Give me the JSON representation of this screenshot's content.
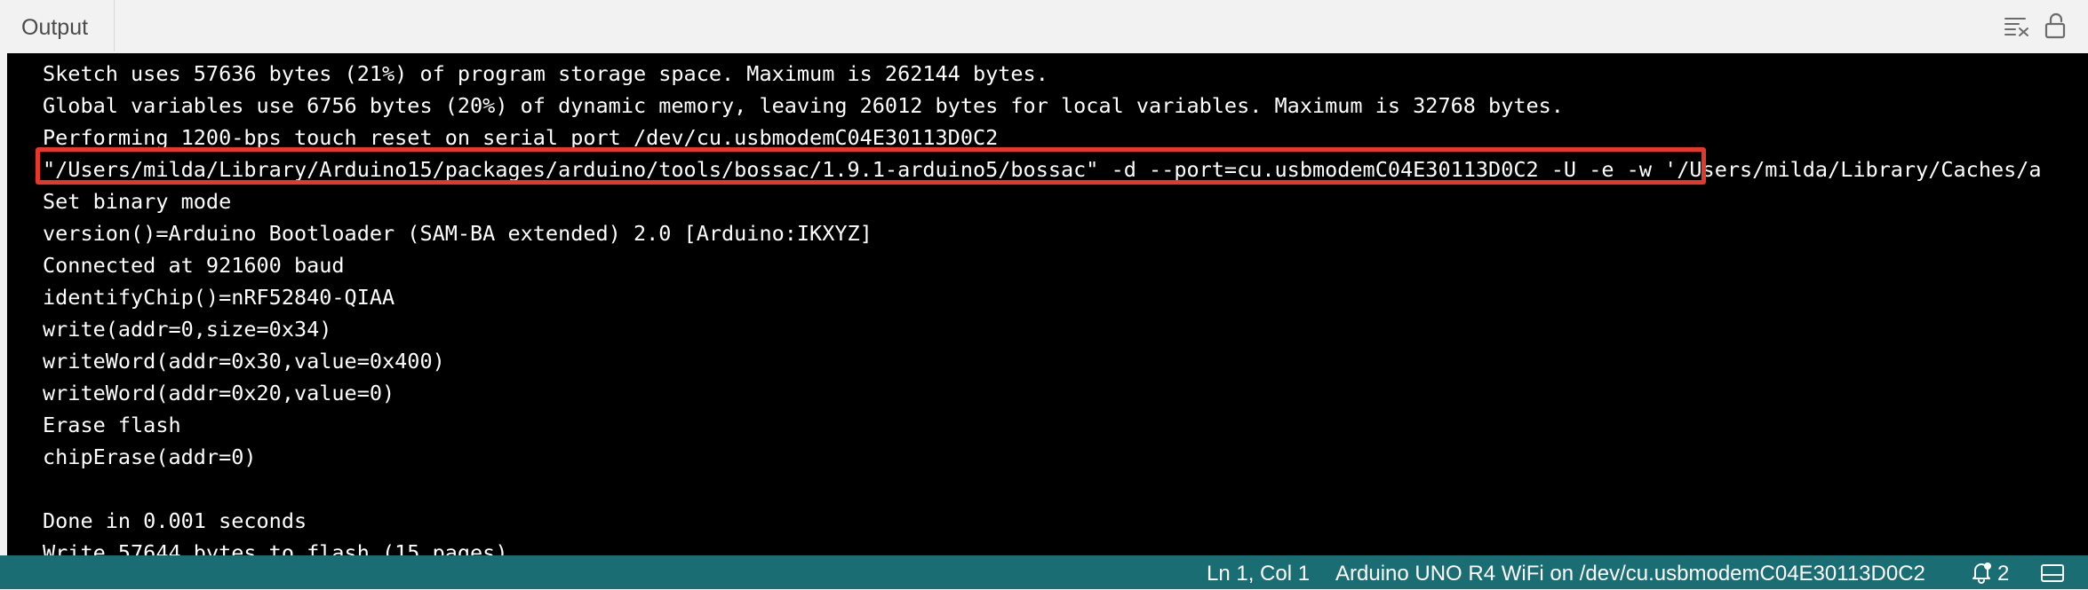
{
  "header": {
    "tab_label": "Output",
    "icons": {
      "clear": "clear-output-icon",
      "lock": "unlock-scroll-icon"
    }
  },
  "console": {
    "lines": [
      "Sketch uses 57636 bytes (21%) of program storage space. Maximum is 262144 bytes.",
      "Global variables use 6756 bytes (20%) of dynamic memory, leaving 26012 bytes for local variables. Maximum is 32768 bytes.",
      "Performing 1200-bps touch reset on serial port /dev/cu.usbmodemC04E30113D0C2",
      "\"/Users/milda/Library/Arduino15/packages/arduino/tools/bossac/1.9.1-arduino5/bossac\" -d --port=cu.usbmodemC04E30113D0C2 -U -e -w '/Users/milda/Library/Caches/a",
      "Set binary mode",
      "version()=Arduino Bootloader (SAM-BA extended) 2.0 [Arduino:IKXYZ]",
      "Connected at 921600 baud",
      "identifyChip()=nRF52840-QIAA",
      "write(addr=0,size=0x34)",
      "writeWord(addr=0x30,value=0x400)",
      "writeWord(addr=0x20,value=0)",
      "Erase flash",
      "chipErase(addr=0)",
      "",
      "Done in 0.001 seconds",
      "Write 57644 bytes to flash (15 pages)"
    ]
  },
  "statusbar": {
    "position": "Ln 1, Col 1",
    "board": "Arduino UNO R4 WiFi on /dev/cu.usbmodemC04E30113D0C2",
    "notifications_count": "2",
    "icons": {
      "notifications": "bell-icon",
      "panel": "toggle-panel-icon"
    }
  },
  "colors": {
    "console_bg": "#000000",
    "console_text": "#ffffff",
    "highlight_border": "#e5382b",
    "statusbar_bg": "#1b6d74",
    "header_bg": "#f2f2f2"
  }
}
